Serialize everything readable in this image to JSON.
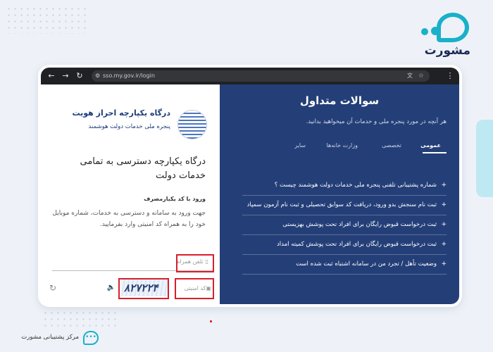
{
  "site": {
    "logo_word": "مشورت",
    "support_label": "مرکز پشتیبانی مشورت"
  },
  "browser": {
    "url": "sso.my.gov.ir/login",
    "back_icon": "arrow-left-icon",
    "forward_icon": "arrow-right-icon",
    "reload_icon": "reload-icon"
  },
  "login": {
    "brand_title": "درگاه یکپارچه احراز هویت",
    "brand_subtitle": "پنجره ملی خدمات دولت هوشمند",
    "main_title": "درگاه یکپارچه دسترسی به تمامی خدمات دولت",
    "section_heading": "ورود با کد یکبارمصرف",
    "description": "جهت ورود به سامانه و دسترسی به خدمات، شماره موبایل خود را به همراه کد امنیتی وارد بفرمایید.",
    "phone_placeholder": "تلفن همراه",
    "captcha_placeholder": "کد امنیتی",
    "captcha_text": "۸۲۷۲۲۴"
  },
  "faq": {
    "title": "سوالات متداول",
    "subtitle": "هر آنچه در مورد پنجره ملی و خدمات آن میخواهید بدانید.",
    "tabs": [
      {
        "label": "عمومی",
        "active": true
      },
      {
        "label": "تخصصی",
        "active": false
      },
      {
        "label": "وزارت خانه‌ها",
        "active": false
      },
      {
        "label": "سایر",
        "active": false
      }
    ],
    "items": [
      "شماره پشتیبانی تلفنی پنجره ملی خدمات دولت هوشمند چیست ؟",
      "ثبت نام سنجش بدو ورود، دریافت کد سوابق تحصیلی و ثبت نام آزمون سمپاد",
      "ثبت درخواست قبوض رایگان برای افراد تحت پوشش بهزیستی",
      "ثبت درخواست قبوض رایگان برای افراد تحت پوشش کمیته امداد",
      "وضعیت تأهل / تجرد من در سامانه اشتباه ثبت شده است"
    ]
  },
  "colors": {
    "brand_teal": "#1ab0c9",
    "panel_navy": "#243f78",
    "highlight_red": "#d8202c"
  }
}
